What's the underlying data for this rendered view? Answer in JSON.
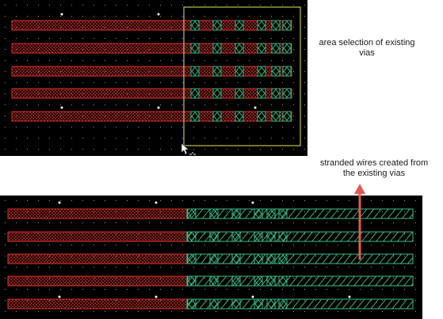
{
  "annotations": {
    "selection_caption": "area selection of existing vias",
    "wires_caption": "stranded wires created from the  existing vias"
  },
  "colors": {
    "canvas_bg": "#000000",
    "wire_red": "#e0302a",
    "via_green": "#3cc08a",
    "selection_box": "#e8e85a",
    "grid_dot": "#9a9a9a",
    "arrow": "#e05a55"
  },
  "layout_top": {
    "wire_count": 5,
    "vias_per_wire": 6,
    "selection_active": true
  },
  "layout_bottom": {
    "wire_count": 5,
    "vias_per_wire": 6,
    "stranded_wires_created": true
  },
  "icons": {
    "cursor": "move-cursor-icon",
    "arrow": "up-arrow-icon"
  }
}
